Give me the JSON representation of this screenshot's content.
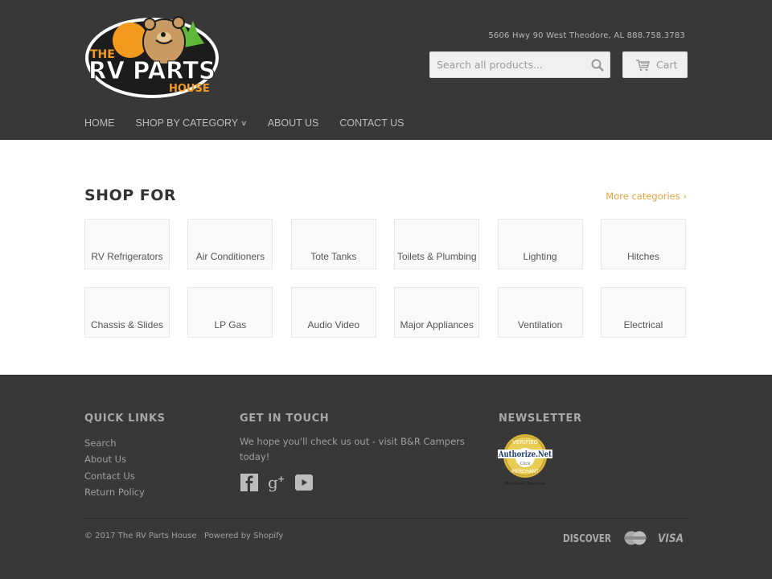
{
  "header": {
    "logo_alt": "The RV Parts House",
    "logo_text": {
      "the": "THE",
      "main": "RV PARTS",
      "house": "HOUSE"
    },
    "address": "5606 Hwy 90 West Theodore, AL 888.758.3783",
    "search": {
      "placeholder": "Search all products...",
      "value": "",
      "icon": "search-icon"
    },
    "cart": {
      "label": "Cart",
      "icon": "cart-icon"
    }
  },
  "nav": {
    "items": [
      {
        "label": "HOME"
      },
      {
        "label": "SHOP BY CATEGORY",
        "has_dropdown": true,
        "icon": "chevron-down-icon"
      },
      {
        "label": "ABOUT US"
      },
      {
        "label": "CONTACT US"
      }
    ]
  },
  "main": {
    "title": "SHOP FOR",
    "more_link": "More categories ›",
    "categories": [
      {
        "label": "RV Refrigerators"
      },
      {
        "label": "Air Conditioners"
      },
      {
        "label": "Tote Tanks"
      },
      {
        "label": "Toilets & Plumbing"
      },
      {
        "label": "Lighting"
      },
      {
        "label": "Hitches"
      },
      {
        "label": "Chassis & Slides"
      },
      {
        "label": "LP Gas"
      },
      {
        "label": "Audio Video"
      },
      {
        "label": "Major Appliances"
      },
      {
        "label": "Ventilation"
      },
      {
        "label": "Electrical"
      }
    ]
  },
  "footer": {
    "quick_links": {
      "heading": "QUICK LINKS",
      "links": [
        {
          "label": "Search"
        },
        {
          "label": "About Us"
        },
        {
          "label": "Contact Us"
        },
        {
          "label": "Return Policy"
        }
      ]
    },
    "get_in_touch": {
      "heading": "GET IN TOUCH",
      "text": "We hope you'll check us out - visit B&R Campers today!",
      "social": [
        "facebook-icon",
        "google-plus-icon",
        "youtube-icon"
      ]
    },
    "newsletter": {
      "heading": "NEWSLETTER",
      "badge": {
        "top": "VERIFIED",
        "brand": "Authorize.Net",
        "click": "Click",
        "bottom": "MERCHANT",
        "caption": "Merchant Services"
      }
    },
    "copyright": "© 2017 The RV Parts House",
    "powered_by": "Powered by Shopify",
    "payments": [
      "DISCOVER",
      "MasterCard",
      "VISA"
    ]
  },
  "colors": {
    "header_bg": "#383838",
    "accent": "#e8a13a",
    "footer_bg": "#383838"
  }
}
